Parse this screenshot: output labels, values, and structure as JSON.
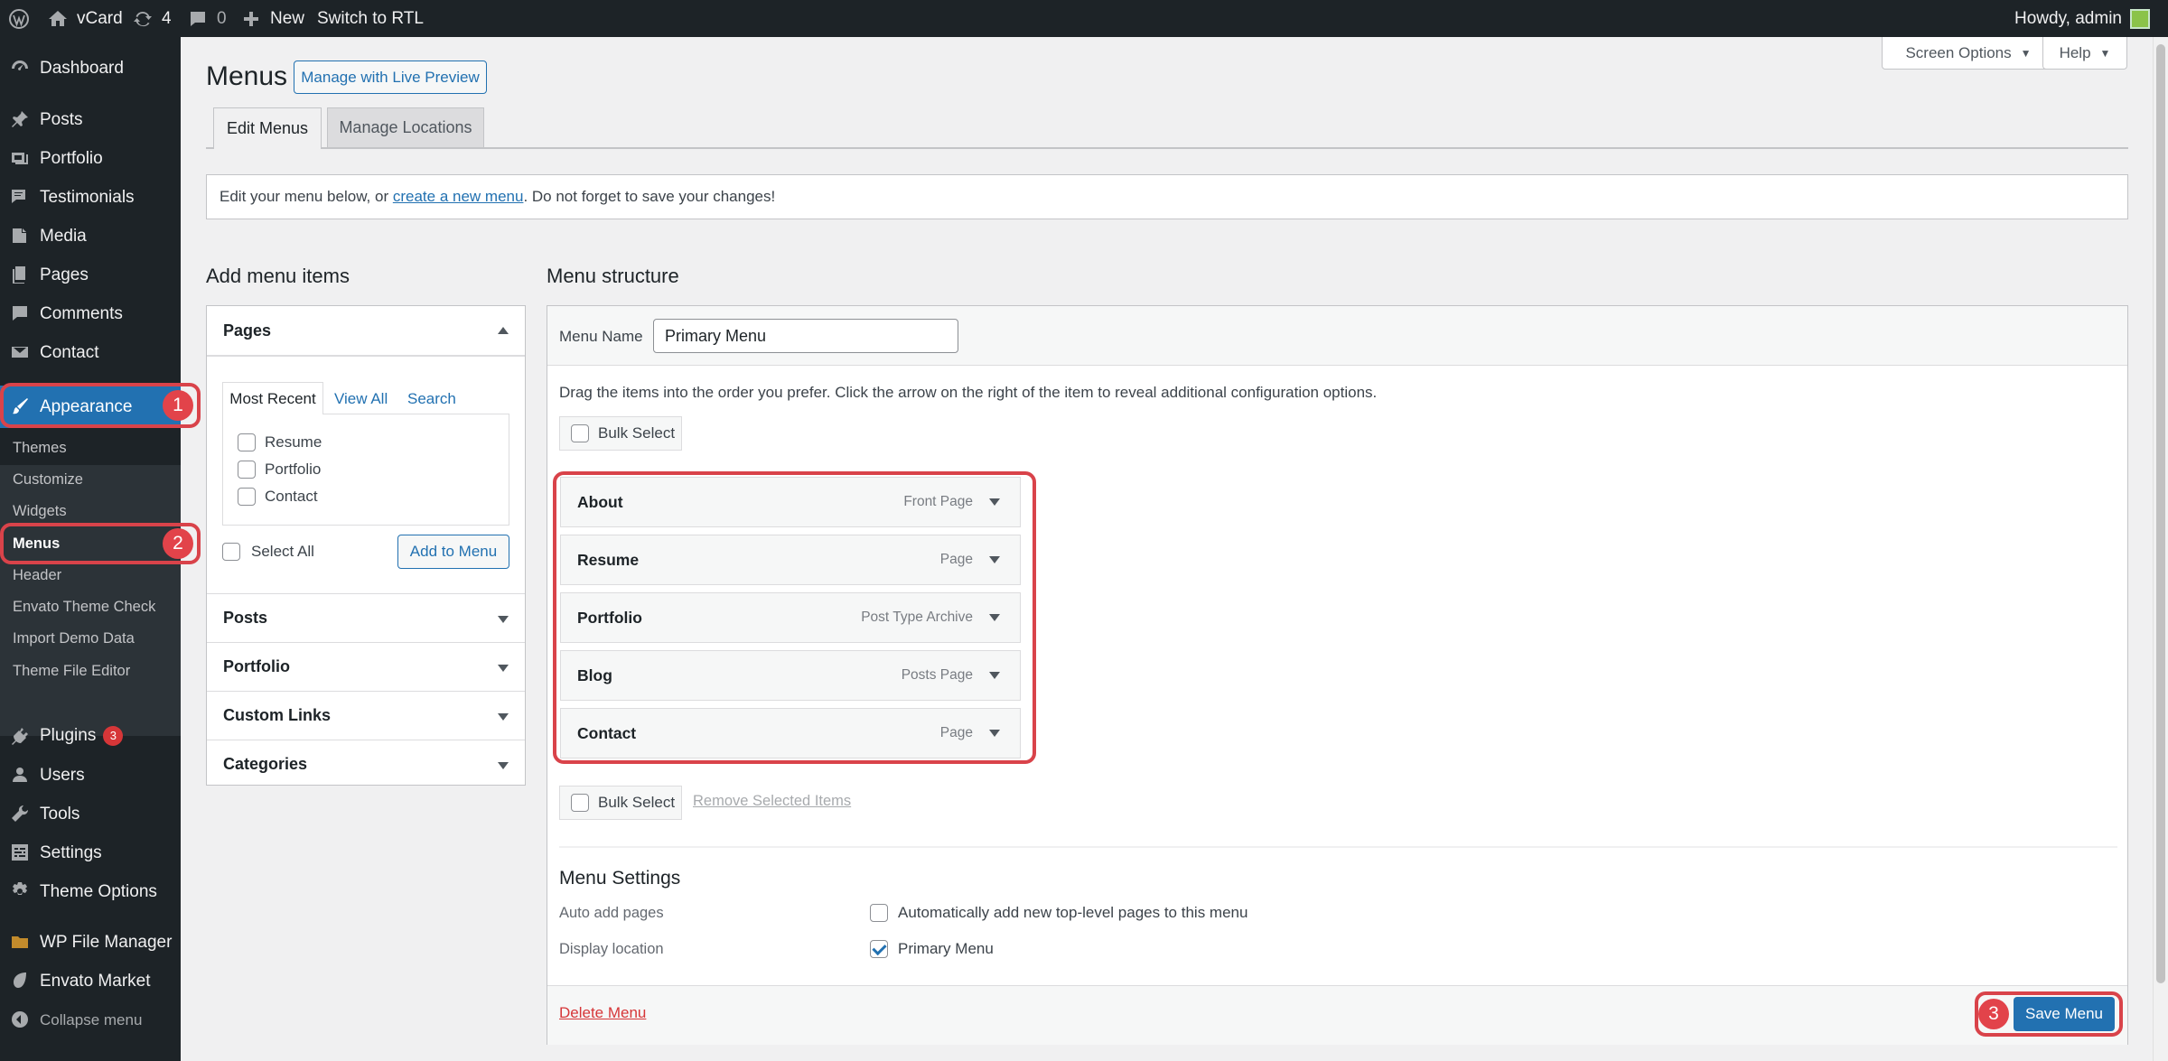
{
  "admin_bar": {
    "site_name": "vCard",
    "updates_count": "4",
    "comments_count": "0",
    "new_label": "New",
    "rtl_label": "Switch to RTL",
    "greeting": "Howdy, admin"
  },
  "sidebar": {
    "items": [
      {
        "label": "Dashboard",
        "icon": "dashboard-icon"
      },
      {
        "label": "Posts",
        "icon": "pin-icon"
      },
      {
        "label": "Portfolio",
        "icon": "portfolio-icon"
      },
      {
        "label": "Testimonials",
        "icon": "testimonial-icon"
      },
      {
        "label": "Media",
        "icon": "media-icon"
      },
      {
        "label": "Pages",
        "icon": "page-icon"
      },
      {
        "label": "Comments",
        "icon": "comment-icon"
      },
      {
        "label": "Contact",
        "icon": "mail-icon"
      },
      {
        "label": "Appearance",
        "icon": "brush-icon"
      }
    ],
    "submenu": [
      "Themes",
      "Customize",
      "Widgets",
      "Menus",
      "Header",
      "Envato Theme Check",
      "Import Demo Data",
      "Theme File Editor"
    ],
    "items_lower": [
      {
        "label": "Plugins",
        "icon": "plugin-icon",
        "badge": "3"
      },
      {
        "label": "Users",
        "icon": "user-icon"
      },
      {
        "label": "Tools",
        "icon": "wrench-icon"
      },
      {
        "label": "Settings",
        "icon": "settings-icon"
      },
      {
        "label": "Theme Options",
        "icon": "gear-icon"
      },
      {
        "label": "WP File Manager",
        "icon": "folder-icon"
      },
      {
        "label": "Envato Market",
        "icon": "leaf-icon"
      }
    ],
    "collapse_label": "Collapse menu"
  },
  "steps": [
    "1",
    "2",
    "3"
  ],
  "header": {
    "title": "Menus",
    "live_preview": "Manage with Live Preview",
    "screen_options": "Screen Options",
    "help": "Help"
  },
  "tabs": [
    "Edit Menus",
    "Manage Locations"
  ],
  "notice": {
    "before": "Edit your menu below, or ",
    "link": "create a new menu",
    "after": ". Do not forget to save your changes!"
  },
  "add_items": {
    "heading": "Add menu items",
    "pages_title": "Pages",
    "page_tabs": [
      "Most Recent",
      "View All",
      "Search"
    ],
    "pages": [
      "Resume",
      "Portfolio",
      "Contact"
    ],
    "select_all": "Select All",
    "add_button": "Add to Menu",
    "sections": [
      "Posts",
      "Portfolio",
      "Custom Links",
      "Categories"
    ]
  },
  "structure": {
    "heading": "Menu structure",
    "menu_name_label": "Menu Name",
    "menu_name_value": "Primary Menu",
    "instructions": "Drag the items into the order you prefer. Click the arrow on the right of the item to reveal additional configuration options.",
    "bulk_select": "Bulk Select",
    "remove_selected": "Remove Selected Items",
    "items": [
      {
        "title": "About",
        "type": "Front Page"
      },
      {
        "title": "Resume",
        "type": "Page"
      },
      {
        "title": "Portfolio",
        "type": "Post Type Archive"
      },
      {
        "title": "Blog",
        "type": "Posts Page"
      },
      {
        "title": "Contact",
        "type": "Page"
      }
    ]
  },
  "settings": {
    "heading": "Menu Settings",
    "auto_add_label": "Auto add pages",
    "auto_add_text": "Automatically add new top-level pages to this menu",
    "auto_add_checked": false,
    "display_label": "Display location",
    "display_text": "Primary Menu",
    "display_checked": true
  },
  "footer": {
    "delete": "Delete Menu",
    "save": "Save Menu"
  },
  "colors": {
    "accent": "#2271b1",
    "admin_bg": "#1d2327",
    "highlight": "#d9434a"
  }
}
